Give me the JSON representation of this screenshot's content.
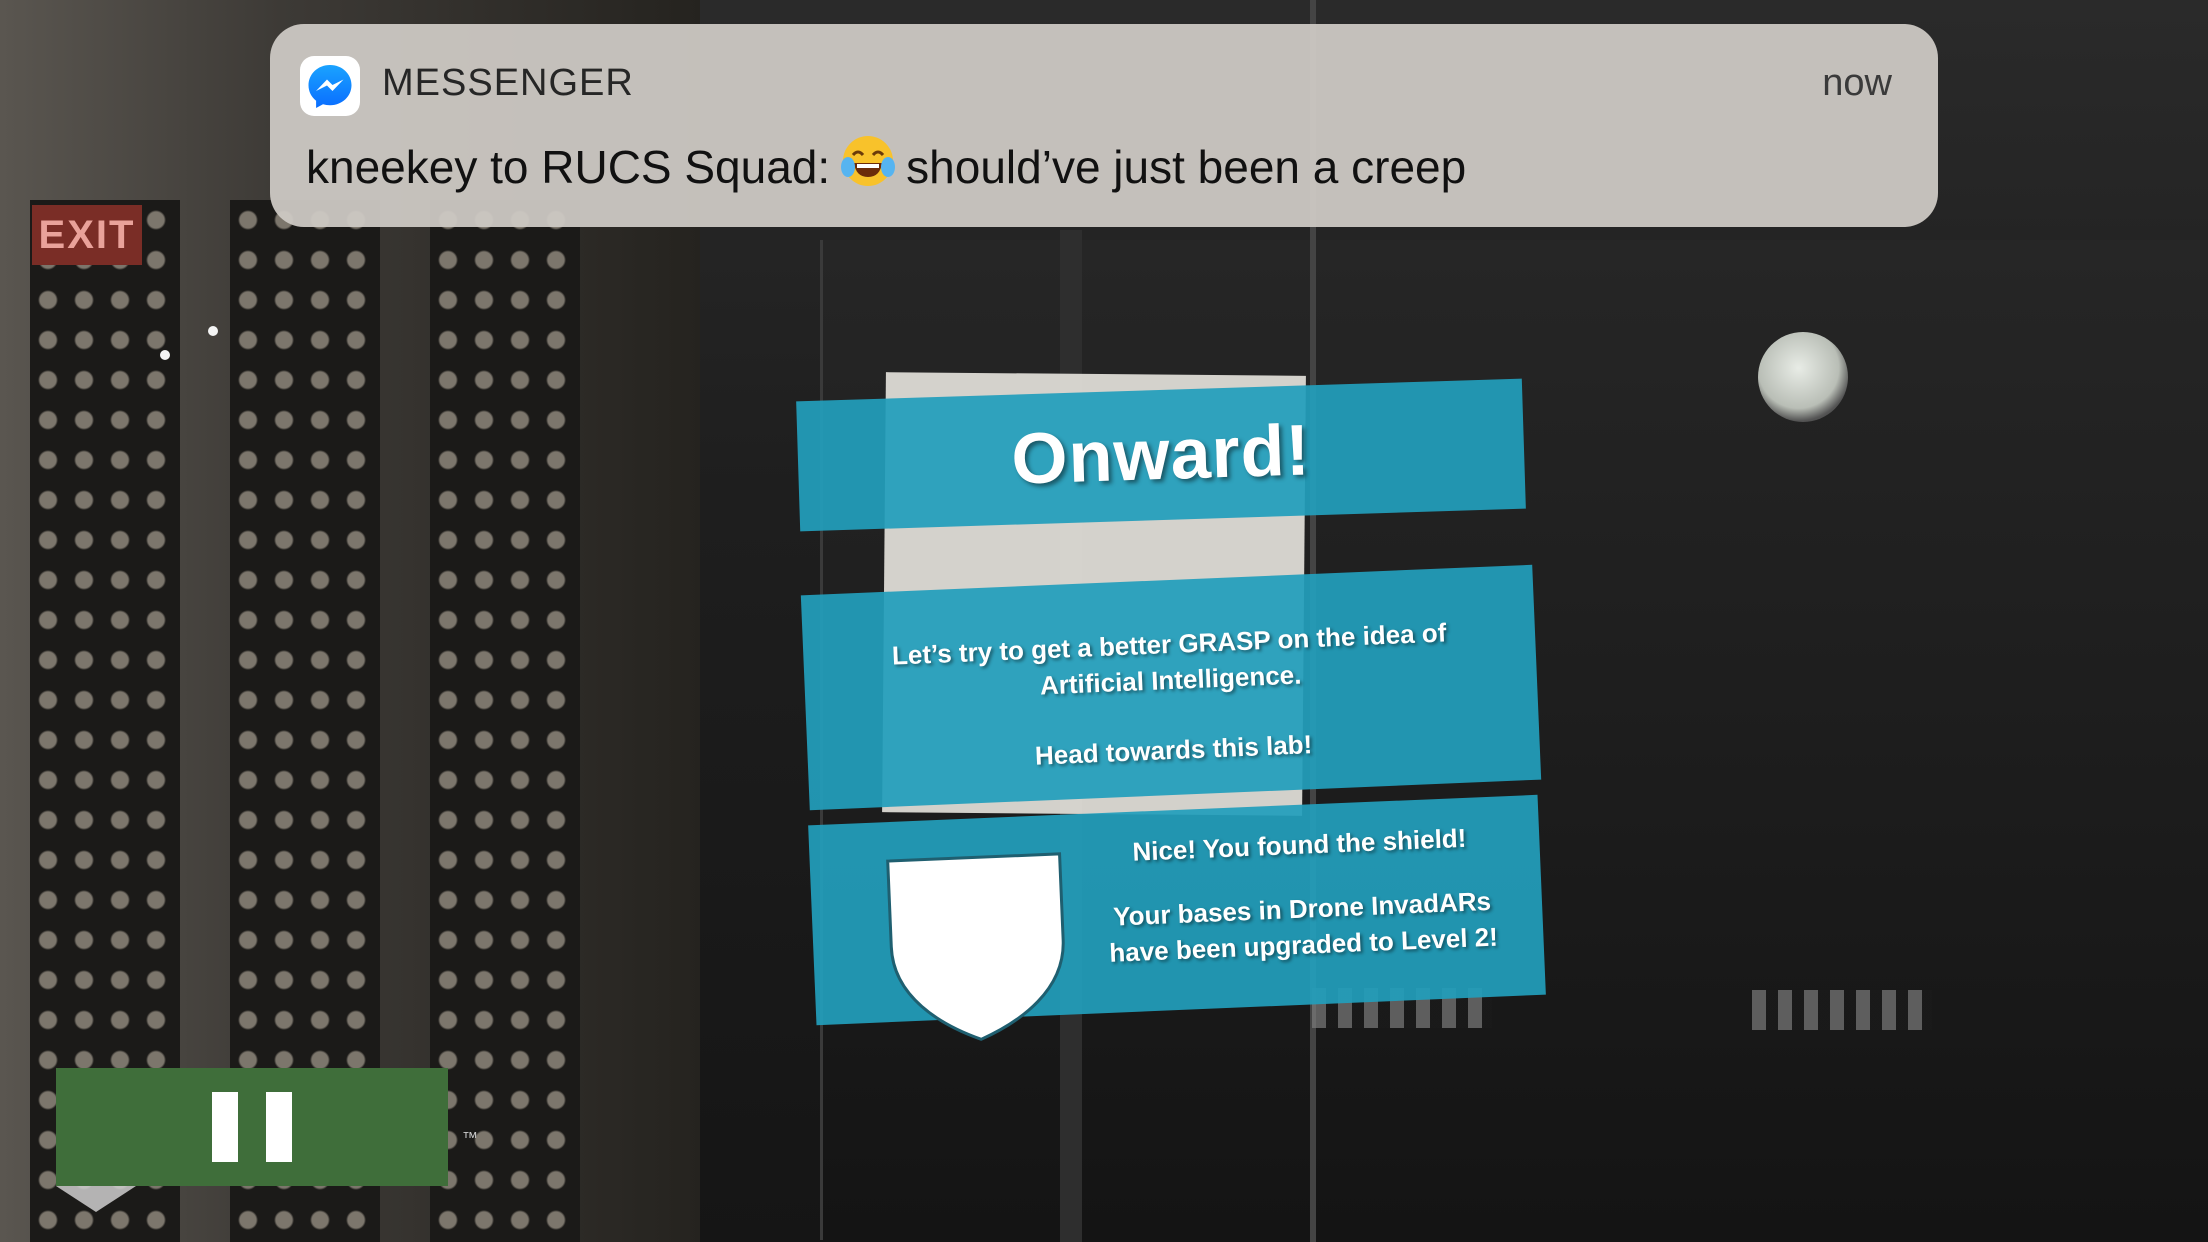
{
  "notification": {
    "app_name": "MESSENGER",
    "time": "now",
    "sender_line": "kneekey to RUCS Squad:",
    "emoji": "face-with-tears-of-joy",
    "message": "should’ve just been a creep",
    "icon": "messenger-icon"
  },
  "background": {
    "exit_sign": "EXIT"
  },
  "ar_panels": {
    "title": "Onward!",
    "info_line1": "Let’s try to get a better GRASP on the idea of",
    "info_line2": "Artificial Intelligence.",
    "info_line3": "Head towards this lab!",
    "reward_line1": "Nice! You found the shield!",
    "reward_line2": "Your bases in Drone InvadARs",
    "reward_line3": "have been upgraded to Level 2!",
    "reward_icon": "shield-icon"
  },
  "controls": {
    "pause_icon": "pause-icon",
    "trademark": "™"
  },
  "colors": {
    "panel": "#229ebb",
    "pause_button": "#3f6e3a",
    "notification_bg": "#cecac5",
    "messenger_blue": "#0a84ff"
  }
}
